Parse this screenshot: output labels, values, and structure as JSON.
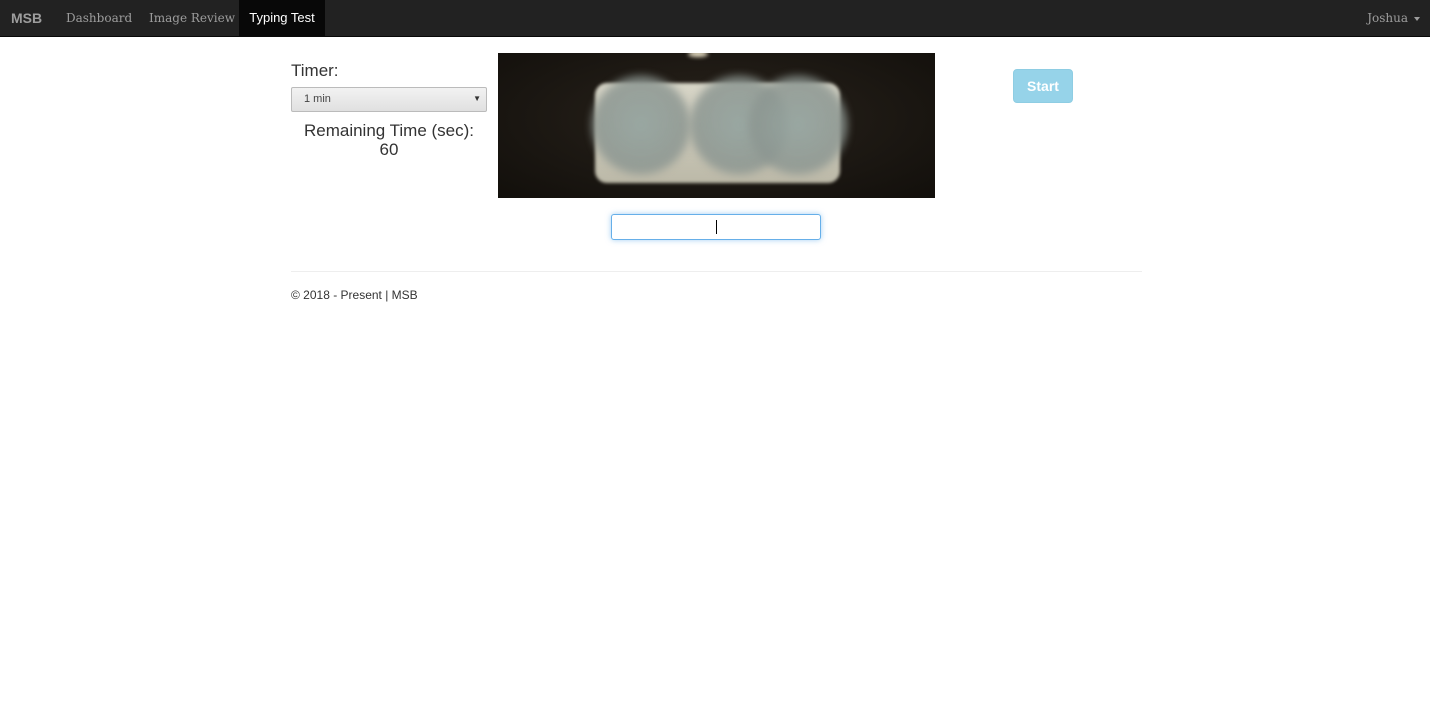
{
  "navbar": {
    "brand": "MSB",
    "items": [
      {
        "label": "Dashboard"
      },
      {
        "label": "Image Review"
      },
      {
        "label": "Typing Test",
        "active": true
      }
    ],
    "user": "Joshua"
  },
  "timer": {
    "label": "Timer:",
    "selected": "1 min",
    "remaining_label": "Remaining Time (sec):",
    "remaining_value": "60"
  },
  "actions": {
    "start_label": "Start"
  },
  "typing": {
    "value": ""
  },
  "footer": {
    "text": "© 2018 - Present | MSB"
  },
  "colors": {
    "navbar_bg": "#222222",
    "active_tab_bg": "#080808",
    "start_button": "#96d3e9",
    "input_focus": "#66afe9"
  },
  "icons": [
    "caret-down-icon",
    "select-arrow-icon"
  ]
}
